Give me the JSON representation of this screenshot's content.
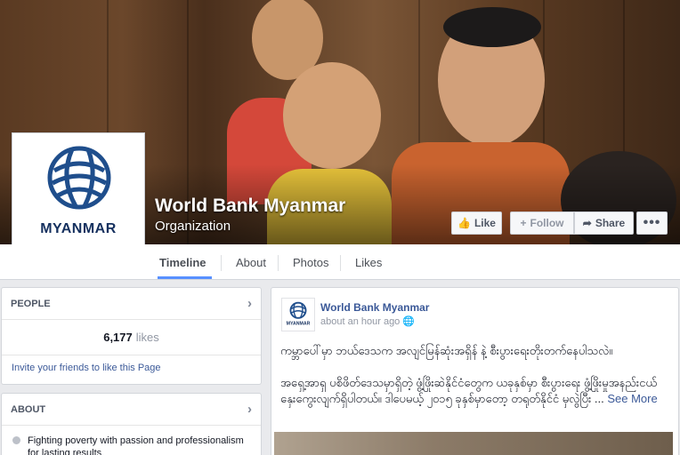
{
  "page": {
    "name": "World Bank Myanmar",
    "category": "Organization",
    "profile_label": "MYANMAR"
  },
  "actions": {
    "like": "Like",
    "follow": "Follow",
    "share": "Share",
    "more": "•••"
  },
  "tabs": [
    {
      "label": "Timeline",
      "active": true
    },
    {
      "label": "About"
    },
    {
      "label": "Photos"
    },
    {
      "label": "Likes"
    }
  ],
  "people": {
    "header": "PEOPLE",
    "count": "6,177",
    "count_unit": "likes",
    "invite": "Invite your friends to like this Page"
  },
  "about": {
    "header": "ABOUT",
    "items": [
      "Fighting poverty with passion and professionalism for lasting results"
    ]
  },
  "post": {
    "author": "World Bank Myanmar",
    "time": "about an hour ago",
    "avatar_label": "MYANMAR",
    "line1": "ကမ္ဘာပေါ်မှာ ဘယ်ဒေသက အလျင်မြန်ဆုံးအရှိန် နဲ့ စီးပွားရေးတိုးတက်နေပါသလဲ။",
    "line2": "အရှေ့အာရှ ပစိဖိတ်ဒေသမှာရှိတဲ့ ဖွံ့ဖြိုးဆဲနိုင်ငံတွေက ယခုနှစ်မှာ စီးပွားရေး ဖွံ့ဖြိုးမှုအနည်းငယ် နှေးကွေးလျက်ရှိပါတယ်။ ဒါပေမယ့် ၂၀၁၅ ခုနှစ်မှာတော့ တရုတ်နိုင်ငံ မှလွဲပြီး ...",
    "see_more": "See More"
  },
  "colors": {
    "brand_blue": "#3b5998",
    "tab_underline": "#5890ff",
    "logo_navy": "#1f4e8c"
  }
}
